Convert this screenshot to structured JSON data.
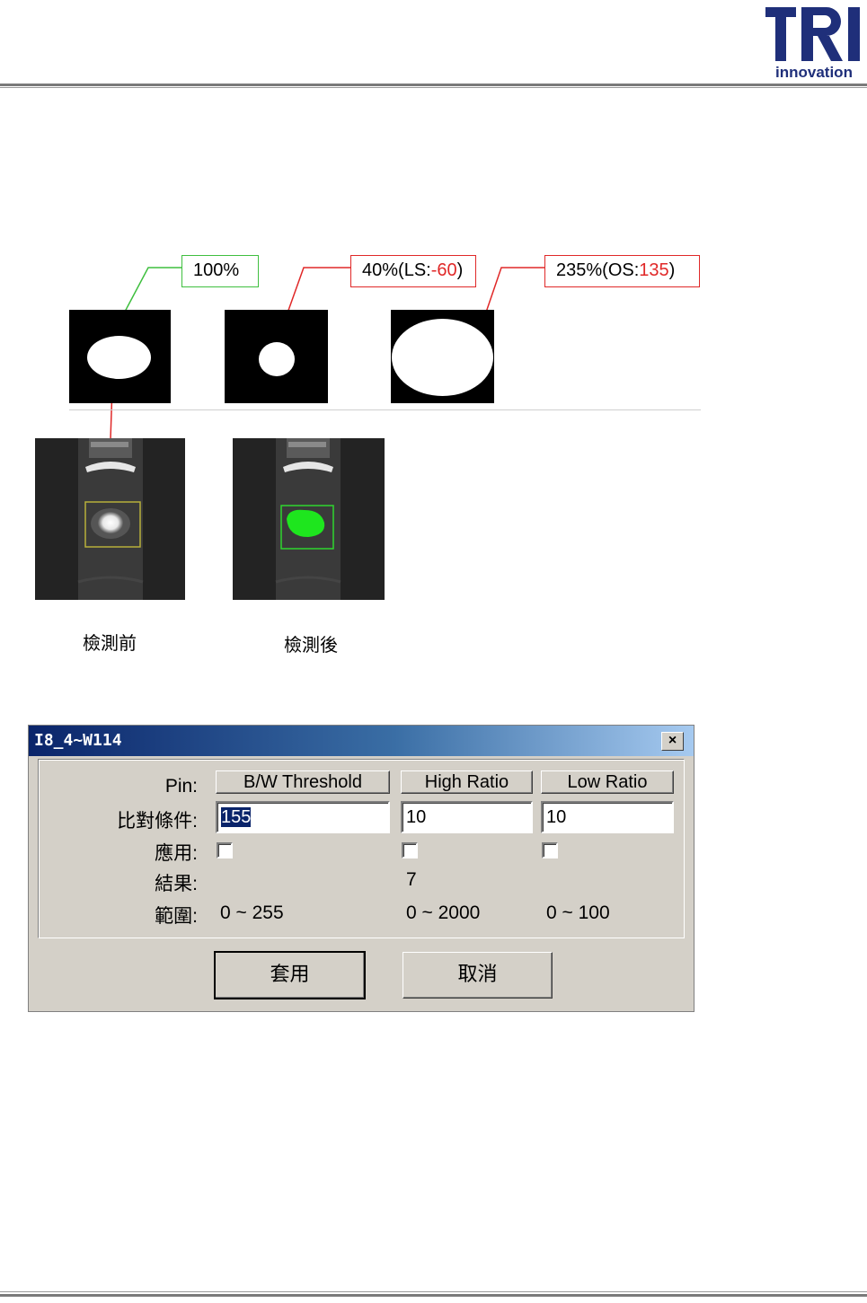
{
  "header": {
    "logo_text": "TRI",
    "logo_subtext": "innovation"
  },
  "illustration": {
    "callout_full": "100%",
    "callout_ls_prefix": "40%(LS:",
    "callout_ls_value": "-60",
    "callout_ls_suffix": ")",
    "callout_os_prefix": "235%(OS:",
    "callout_os_value": "135",
    "callout_os_suffix": ")",
    "caption_before": "檢測前",
    "caption_after": "檢測後"
  },
  "dialog": {
    "title": "I8_4~W114",
    "close_symbol": "×",
    "row_labels": {
      "pin": "Pin:",
      "compare": "比對條件:",
      "apply": "應用:",
      "result": "結果:",
      "range": "範圍:"
    },
    "columns": [
      {
        "header": "B/W Threshold",
        "value": "155",
        "applied": false,
        "result": "",
        "range": "0 ~ 255"
      },
      {
        "header": "High Ratio",
        "value": "10",
        "applied": false,
        "result": "7",
        "range": "0 ~ 2000"
      },
      {
        "header": "Low Ratio",
        "value": "10",
        "applied": false,
        "result": "",
        "range": "0 ~ 100"
      }
    ],
    "apply_button": "套用",
    "cancel_button": "取消"
  },
  "colors": {
    "ok_green": "#3fbf3f",
    "ng_red": "#e02828",
    "titlebar": "#0a246a",
    "dialog_face": "#d4d0c8"
  }
}
